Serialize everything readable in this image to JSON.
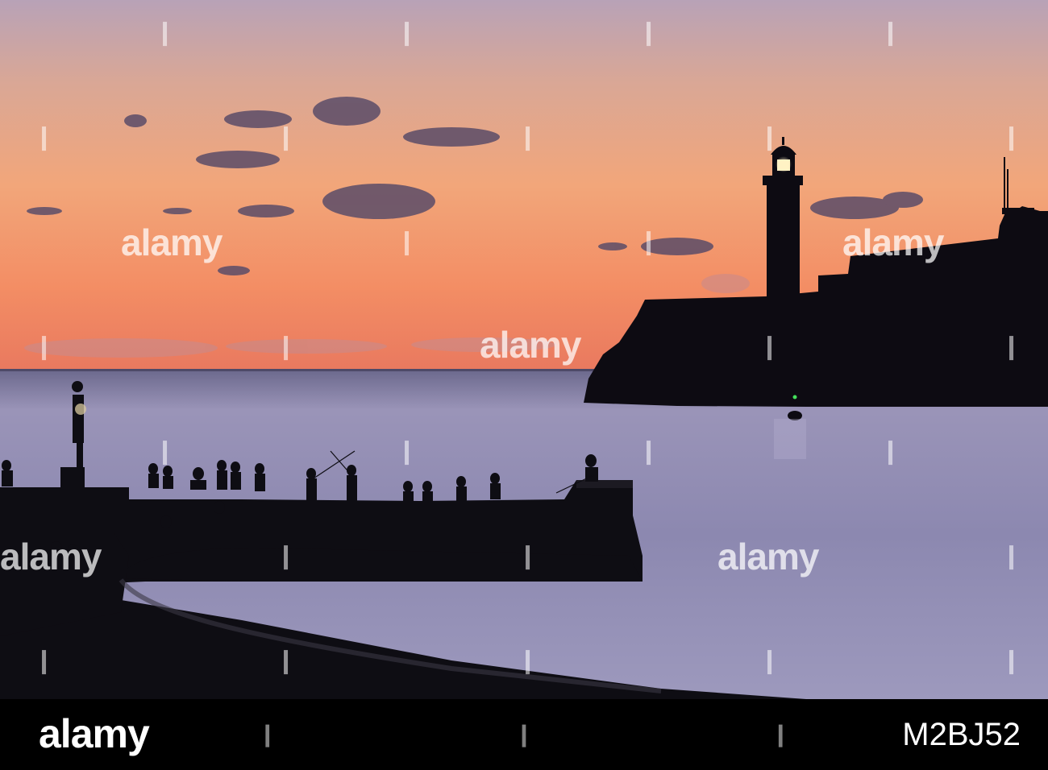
{
  "watermark": {
    "brand": "alamy",
    "dot_glyph": "❙"
  },
  "footer": {
    "logo": "alamy",
    "image_id": "M2BJ52"
  },
  "colors": {
    "sky_top": "#b7a0b6",
    "sky_mid": "#f0a57a",
    "horizon": "#f07f5a",
    "sea": "#8f8bb2",
    "silhouette": "#0b0a0f"
  }
}
